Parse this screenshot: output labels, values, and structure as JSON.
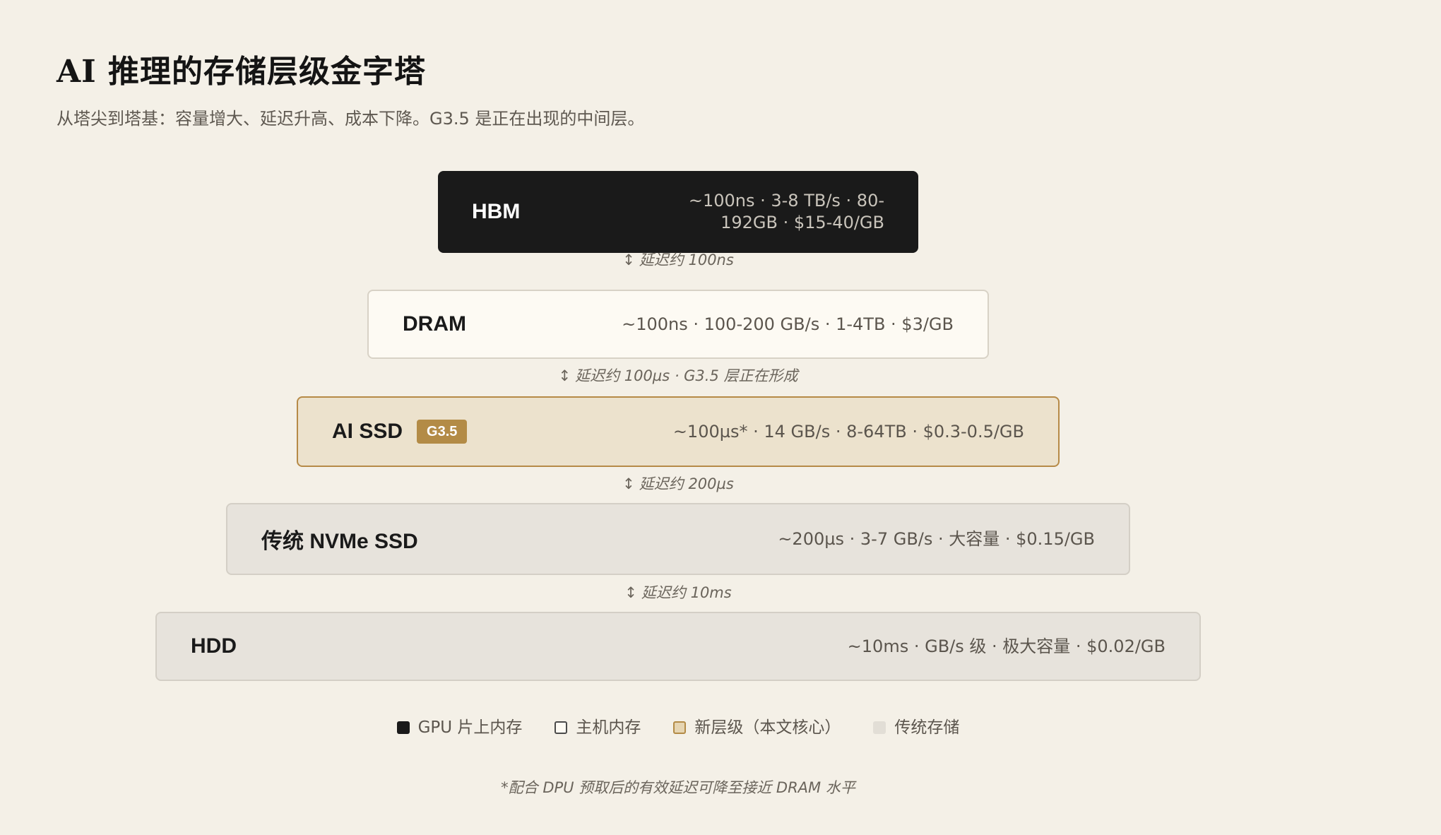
{
  "header": {
    "title": "AI 推理的存储层级金字塔",
    "subtitle": "从塔尖到塔基：容量增大、延迟升高、成本下降。G3.5 是正在出现的中间层。"
  },
  "colors": {
    "background": "#f4f0e7",
    "gpu_memory": "#1a1a1a",
    "host_memory": "#fdfaf3",
    "new_tier": "#ece2cd",
    "new_tier_accent": "#b38b46",
    "legacy_storage": "#e7e3dc"
  },
  "tiers": [
    {
      "name": "HBM",
      "stats": "~100ns · 3-8 TB/s · 80-192GB · $15-40/GB",
      "category": "gpu"
    },
    {
      "name": "DRAM",
      "stats": "~100ns · 100-200 GB/s · 1-4TB · $3/GB",
      "category": "host"
    },
    {
      "name": "AI SSD",
      "badge": "G3.5",
      "stats": "~100µs* · 14 GB/s · 8-64TB · $0.3-0.5/GB",
      "category": "new"
    },
    {
      "name": "传统 NVMe SSD",
      "stats": "~200µs · 3-7 GB/s · 大容量 · $0.15/GB",
      "category": "legacy"
    },
    {
      "name": "HDD",
      "stats": "~10ms · GB/s 级 · 极大容量 · $0.02/GB",
      "category": "legacy"
    }
  ],
  "connectors": [
    {
      "icon": "vertical-double-arrow-icon",
      "arrow": "↕",
      "label": "延迟约 100ns"
    },
    {
      "icon": "vertical-double-arrow-icon",
      "arrow": "↕",
      "label": "延迟约 100µs · G3.5 层正在形成"
    },
    {
      "icon": "vertical-double-arrow-icon",
      "arrow": "↕",
      "label": "延迟约 200µs"
    },
    {
      "icon": "vertical-double-arrow-icon",
      "arrow": "↕",
      "label": "延迟约 10ms"
    }
  ],
  "legend": [
    {
      "label": "GPU 片上内存"
    },
    {
      "label": "主机内存"
    },
    {
      "label": "新层级（本文核心）"
    },
    {
      "label": "传统存储"
    }
  ],
  "footnote": "*配合 DPU 预取后的有效延迟可降至接近 DRAM 水平"
}
